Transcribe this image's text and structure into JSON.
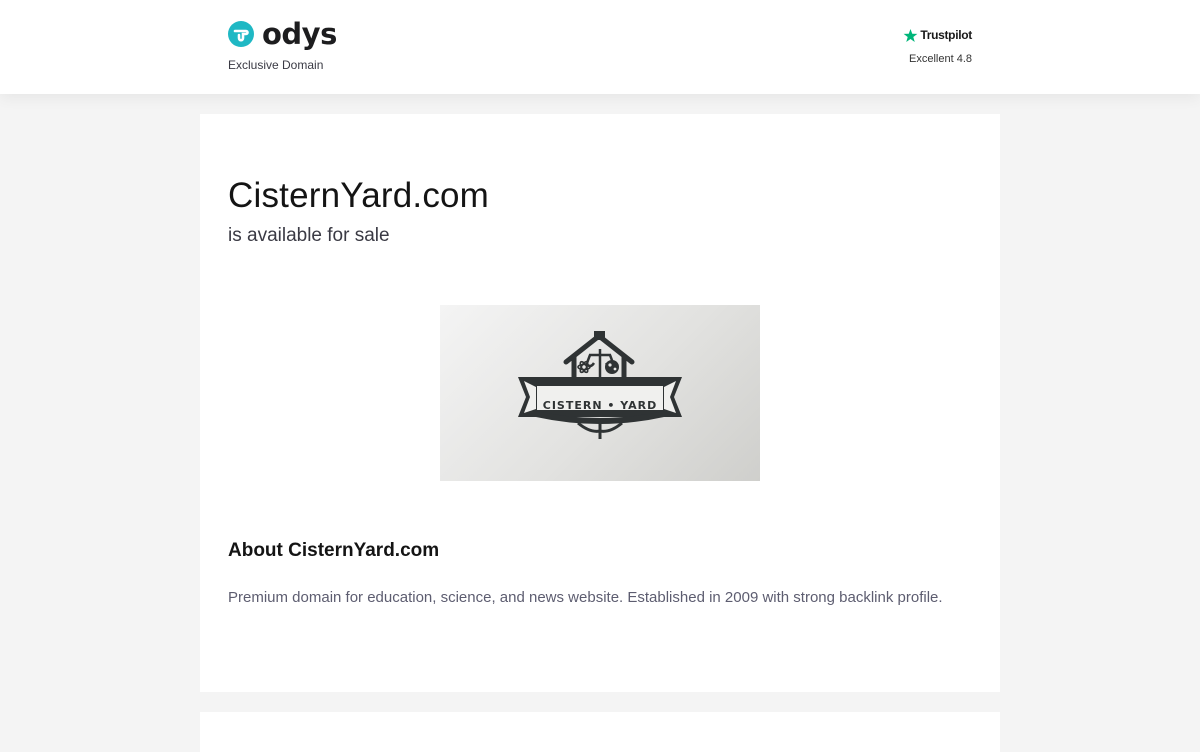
{
  "header": {
    "brand_name": "odys",
    "brand_tagline": "Exclusive Domain",
    "trustpilot": {
      "name": "Trustpilot",
      "rating_text": "Excellent 4.8",
      "star_color": "#00b67a"
    },
    "brand_color": "#1fb8c4"
  },
  "listing": {
    "domain": "CisternYard.com",
    "status": "is available for sale",
    "logo_text": "CISTERN • YARD",
    "about_title": "About CisternYard.com",
    "about_text": "Premium domain for education, science, and news website. Established in 2009 with strong backlink profile."
  }
}
